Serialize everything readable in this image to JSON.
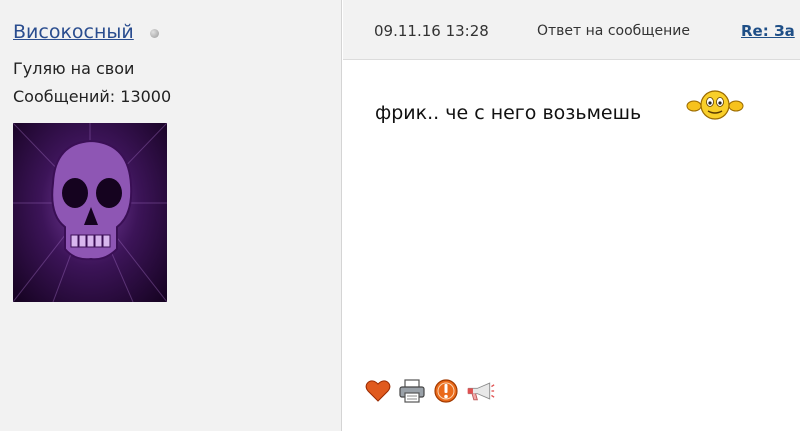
{
  "user": {
    "name": "Високосный",
    "title": "Гуляю на свои",
    "posts_label": "Сообщений: 13000",
    "status_icon": "offline-dot-icon"
  },
  "message": {
    "date": "09.11.16 13:28",
    "reply_label": "Ответ на сообщение",
    "thread_link": "Re: За",
    "text": "фрик.. че с него возьмешь",
    "emoticon": "waving-smiley-icon"
  },
  "actions": [
    {
      "icon": "heart-icon"
    },
    {
      "icon": "printer-icon"
    },
    {
      "icon": "warning-icon"
    },
    {
      "icon": "megaphone-icon"
    }
  ],
  "colors": {
    "username": "#2a4d8f",
    "link": "#1f4f87",
    "panel_bg": "#f2f2f2",
    "heart": "#e05a1e"
  }
}
